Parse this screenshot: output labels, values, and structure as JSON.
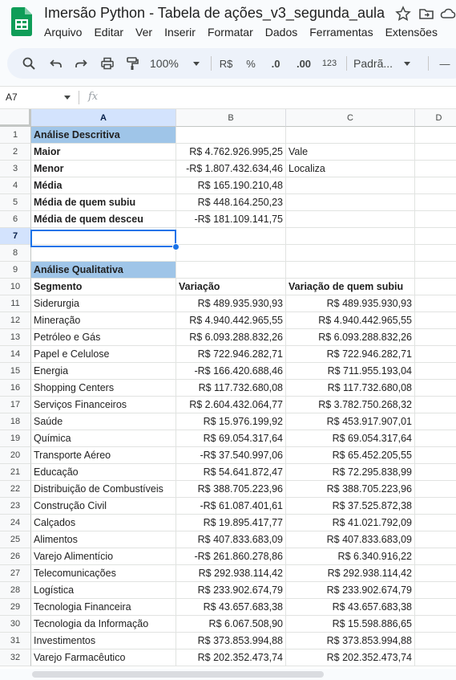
{
  "app": {
    "title": "Imersão Python - Tabela de ações_v3_segunda_aula",
    "menu": [
      "Arquivo",
      "Editar",
      "Ver",
      "Inserir",
      "Formatar",
      "Dados",
      "Ferramentas",
      "Extensões"
    ]
  },
  "toolbar": {
    "zoom": "100%",
    "currency": "R$",
    "percent": "%",
    "dec_decrease": ".0",
    "dec_increase": ".00",
    "format_123": "123",
    "font": "Padrã...",
    "minus": "—"
  },
  "formula_bar": {
    "name_box": "A7",
    "fx": "fx",
    "value": ""
  },
  "columns": [
    "A",
    "B",
    "C",
    "D"
  ],
  "selected_cell": "A7",
  "rows": [
    {
      "n": "1",
      "a": "Análise Descritiva",
      "b": "",
      "c": ""
    },
    {
      "n": "2",
      "a": "Maior",
      "b": "R$ 4.762.926.995,25",
      "c": "Vale"
    },
    {
      "n": "3",
      "a": "Menor",
      "b": "-R$ 1.807.432.634,46",
      "c": "Localiza"
    },
    {
      "n": "4",
      "a": "Média",
      "b": "R$ 165.190.210,48",
      "c": ""
    },
    {
      "n": "5",
      "a": "Média de quem subiu",
      "b": "R$ 448.164.250,23",
      "c": ""
    },
    {
      "n": "6",
      "a": "Média de quem desceu",
      "b": "-R$ 181.109.141,75",
      "c": ""
    },
    {
      "n": "7",
      "a": "",
      "b": "",
      "c": ""
    },
    {
      "n": "8",
      "a": "",
      "b": "",
      "c": ""
    },
    {
      "n": "9",
      "a": "Análise Qualitativa",
      "b": "",
      "c": ""
    },
    {
      "n": "10",
      "a": "Segmento",
      "b": "Variação",
      "c": "Variação de quem subiu"
    },
    {
      "n": "11",
      "a": "Siderurgia",
      "b": "R$ 489.935.930,93",
      "c": "R$ 489.935.930,93"
    },
    {
      "n": "12",
      "a": "Mineração",
      "b": "R$ 4.940.442.965,55",
      "c": "R$ 4.940.442.965,55"
    },
    {
      "n": "13",
      "a": "Petróleo e Gás",
      "b": "R$ 6.093.288.832,26",
      "c": "R$ 6.093.288.832,26"
    },
    {
      "n": "14",
      "a": "Papel e Celulose",
      "b": "R$ 722.946.282,71",
      "c": "R$ 722.946.282,71"
    },
    {
      "n": "15",
      "a": "Energia",
      "b": "-R$ 166.420.688,46",
      "c": "R$ 711.955.193,04"
    },
    {
      "n": "16",
      "a": "Shopping Centers",
      "b": "R$ 117.732.680,08",
      "c": "R$ 117.732.680,08"
    },
    {
      "n": "17",
      "a": "Serviços Financeiros",
      "b": "R$ 2.604.432.064,77",
      "c": "R$ 3.782.750.268,32"
    },
    {
      "n": "18",
      "a": "Saúde",
      "b": "R$ 15.976.199,92",
      "c": "R$ 453.917.907,01"
    },
    {
      "n": "19",
      "a": "Química",
      "b": "R$ 69.054.317,64",
      "c": "R$ 69.054.317,64"
    },
    {
      "n": "20",
      "a": "Transporte Aéreo",
      "b": "-R$ 37.540.997,06",
      "c": "R$ 65.452.205,55"
    },
    {
      "n": "21",
      "a": "Educação",
      "b": "R$ 54.641.872,47",
      "c": "R$ 72.295.838,99"
    },
    {
      "n": "22",
      "a": "Distribuição de Combustíveis",
      "b": "R$ 388.705.223,96",
      "c": "R$ 388.705.223,96"
    },
    {
      "n": "23",
      "a": "Construção Civil",
      "b": "-R$ 61.087.401,61",
      "c": "R$ 37.525.872,38"
    },
    {
      "n": "24",
      "a": "Calçados",
      "b": "R$ 19.895.417,77",
      "c": "R$ 41.021.792,09"
    },
    {
      "n": "25",
      "a": "Alimentos",
      "b": "R$ 407.833.683,09",
      "c": "R$ 407.833.683,09"
    },
    {
      "n": "26",
      "a": "Varejo Alimentício",
      "b": "-R$ 261.860.278,86",
      "c": "R$ 6.340.916,22"
    },
    {
      "n": "27",
      "a": "Telecomunicações",
      "b": "R$ 292.938.114,42",
      "c": "R$ 292.938.114,42"
    },
    {
      "n": "28",
      "a": "Logística",
      "b": "R$ 233.902.674,79",
      "c": "R$ 233.902.674,79"
    },
    {
      "n": "29",
      "a": "Tecnologia Financeira",
      "b": "R$ 43.657.683,38",
      "c": "R$ 43.657.683,38"
    },
    {
      "n": "30",
      "a": "Tecnologia da Informação",
      "b": "R$ 6.067.508,90",
      "c": "R$ 15.598.886,65"
    },
    {
      "n": "31",
      "a": "Investimentos",
      "b": "R$ 373.853.994,88",
      "c": "R$ 373.853.994,88"
    },
    {
      "n": "32",
      "a": "Varejo Farmacêutico",
      "b": "R$ 202.352.473,74",
      "c": "R$ 202.352.473,74"
    }
  ],
  "colors": {
    "header_fill": "#9fc5e8",
    "selection": "#1a73e8",
    "sheets_green": "#0f9d58"
  }
}
